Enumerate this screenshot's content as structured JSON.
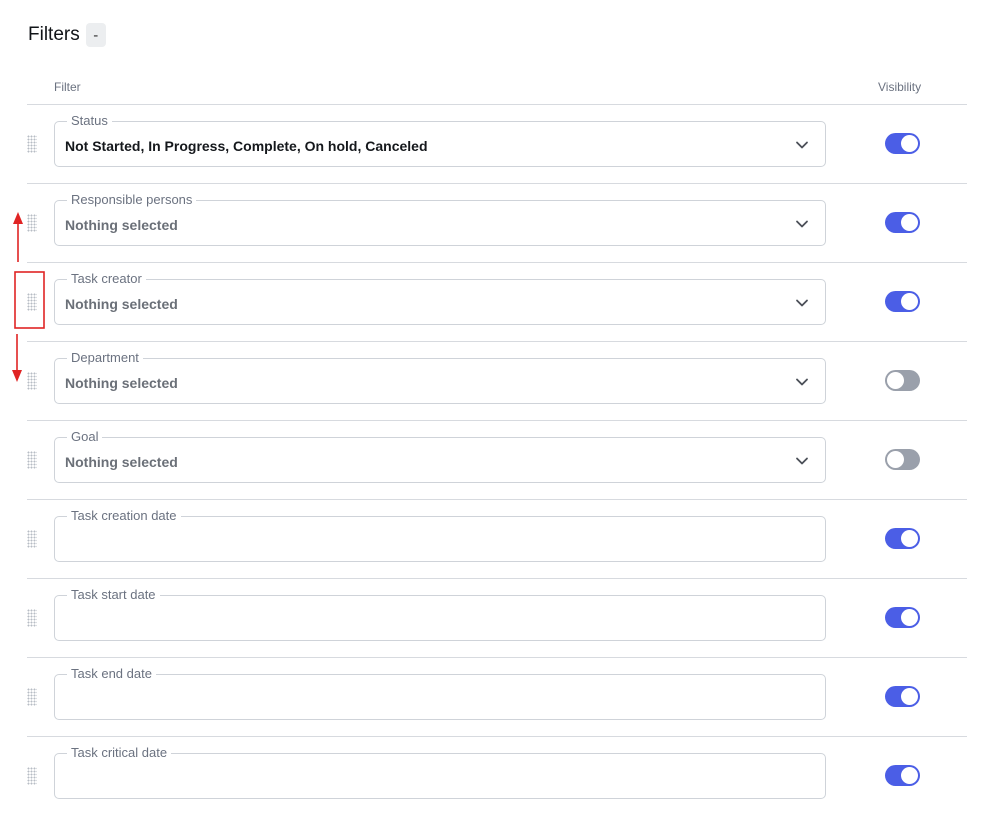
{
  "header": {
    "title": "Filters",
    "collapse_label": "-"
  },
  "columns": {
    "filter": "Filter",
    "visibility": "Visibility"
  },
  "filters": [
    {
      "label": "Status",
      "value": "Not Started, In Progress, Complete, On hold, Canceled",
      "has_selection": true,
      "type": "select",
      "visible": true
    },
    {
      "label": "Responsible persons",
      "value": "Nothing selected",
      "has_selection": false,
      "type": "select",
      "visible": true
    },
    {
      "label": "Task creator",
      "value": "Nothing selected",
      "has_selection": false,
      "type": "select",
      "visible": true
    },
    {
      "label": "Department",
      "value": "Nothing selected",
      "has_selection": false,
      "type": "select",
      "visible": false
    },
    {
      "label": "Goal",
      "value": "Nothing selected",
      "has_selection": false,
      "type": "select",
      "visible": false
    },
    {
      "label": "Task creation date",
      "value": "",
      "has_selection": false,
      "type": "date",
      "visible": true
    },
    {
      "label": "Task start date",
      "value": "",
      "has_selection": false,
      "type": "date",
      "visible": true
    },
    {
      "label": "Task end date",
      "value": "",
      "has_selection": false,
      "type": "date",
      "visible": true
    },
    {
      "label": "Task critical date",
      "value": "",
      "has_selection": false,
      "type": "date",
      "visible": true
    }
  ],
  "colors": {
    "toggle_on": "#4b5ee6",
    "toggle_off": "#9aa0ab",
    "annotation": "#e02424"
  },
  "icons": {
    "drag": "drag-handle-icon",
    "chevron": "chevron-down-icon"
  }
}
